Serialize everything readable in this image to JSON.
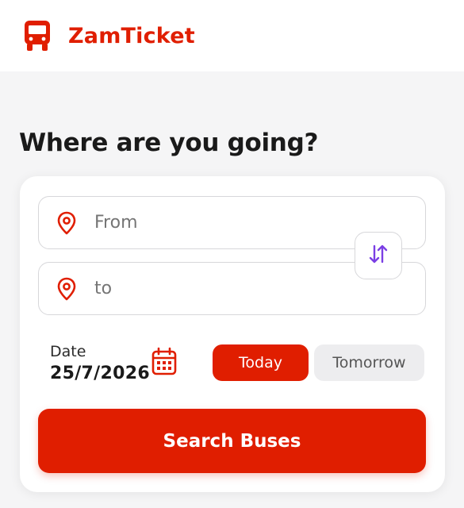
{
  "header": {
    "brand": "ZamTicket",
    "logo_icon": "bus-icon"
  },
  "main": {
    "heading": "Where are you going?"
  },
  "form": {
    "from_placeholder": "From",
    "to_placeholder": "to",
    "from_icon": "location-pin-icon",
    "to_icon": "location-pin-icon",
    "swap_icon": "swap-vertical-arrows-icon",
    "date_label": "Date",
    "date_value": "25/7/2026",
    "calendar_icon": "calendar-icon",
    "chips": [
      {
        "label": "Today",
        "selected": true
      },
      {
        "label": "Tomorrow",
        "selected": false
      }
    ],
    "search_label": "Search Buses"
  },
  "colors": {
    "brand_red": "#e01e00",
    "swap_purple": "#7b3fe4",
    "background": "#f5f5f6"
  }
}
